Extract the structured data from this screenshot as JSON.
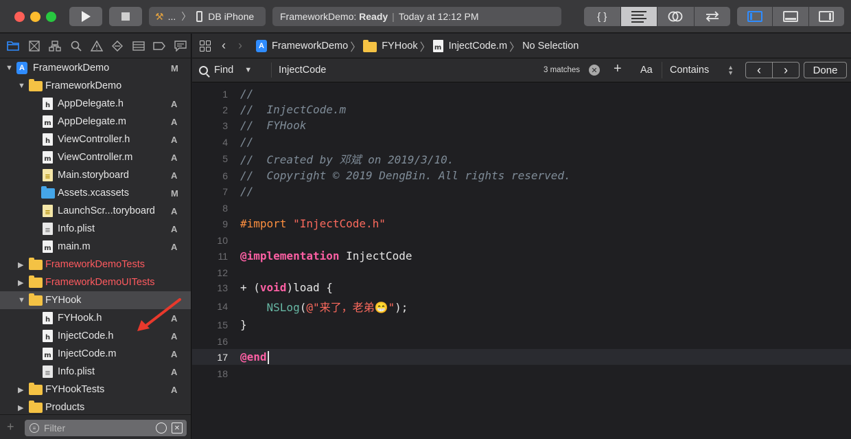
{
  "toolbar": {
    "scheme_dots": "...",
    "destination": "DB iPhone",
    "activity_project": "FrameworkDemo:",
    "activity_status": "Ready",
    "activity_time": "Today at 12:12 PM",
    "editor_modes": [
      "code-review-icon",
      "standard-editor-icon",
      "assistant-editor-icon",
      "version-editor-icon"
    ],
    "editor_standard_glyph": "{ }"
  },
  "navigator": {
    "tabs": [
      "folder-icon",
      "source-control-icon",
      "symbol-icon",
      "search-icon",
      "warning-icon",
      "test-icon",
      "debug-icon",
      "breakpoint-icon",
      "report-icon"
    ],
    "items": [
      {
        "label": "FrameworkDemo",
        "status": "M",
        "kind": "project"
      },
      {
        "label": "FrameworkDemo",
        "status": "",
        "kind": "folder"
      },
      {
        "label": "AppDelegate.h",
        "status": "A",
        "kind": "h"
      },
      {
        "label": "AppDelegate.m",
        "status": "A",
        "kind": "m"
      },
      {
        "label": "ViewController.h",
        "status": "A",
        "kind": "h"
      },
      {
        "label": "ViewController.m",
        "status": "A",
        "kind": "m"
      },
      {
        "label": "Main.storyboard",
        "status": "A",
        "kind": "storyboard"
      },
      {
        "label": "Assets.xcassets",
        "status": "M",
        "kind": "assets"
      },
      {
        "label": "LaunchScr...toryboard",
        "status": "A",
        "kind": "storyboard"
      },
      {
        "label": "Info.plist",
        "status": "A",
        "kind": "plist"
      },
      {
        "label": "main.m",
        "status": "A",
        "kind": "m"
      },
      {
        "label": "FrameworkDemoTests",
        "status": "",
        "kind": "folder-red"
      },
      {
        "label": "FrameworkDemoUITests",
        "status": "",
        "kind": "folder-red"
      },
      {
        "label": "FYHook",
        "status": "",
        "kind": "folder"
      },
      {
        "label": "FYHook.h",
        "status": "A",
        "kind": "h"
      },
      {
        "label": "InjectCode.h",
        "status": "A",
        "kind": "h"
      },
      {
        "label": "InjectCode.m",
        "status": "A",
        "kind": "m"
      },
      {
        "label": "Info.plist",
        "status": "A",
        "kind": "plist"
      },
      {
        "label": "FYHookTests",
        "status": "A",
        "kind": "folder"
      },
      {
        "label": "Products",
        "status": "",
        "kind": "folder"
      }
    ],
    "filter_placeholder": "Filter"
  },
  "jumpbar": {
    "crumbs": [
      "FrameworkDemo",
      "FYHook",
      "InjectCode.m",
      "No Selection"
    ]
  },
  "findbar": {
    "mode": "Find",
    "query": "InjectCode",
    "match_count": "3 matches",
    "case_label": "Aa",
    "match_type": "Contains",
    "done_label": "Done"
  },
  "code": {
    "current_line": 17,
    "lines": [
      {
        "n": "1",
        "text": "//"
      },
      {
        "n": "2",
        "text": "//  InjectCode.m"
      },
      {
        "n": "3",
        "text": "//  FYHook"
      },
      {
        "n": "4",
        "text": "//"
      },
      {
        "n": "5",
        "text": "//  Created by 邓斌 on 2019/3/10."
      },
      {
        "n": "6",
        "text": "//  Copyright © 2019 DengBin. All rights reserved."
      },
      {
        "n": "7",
        "text": "//"
      },
      {
        "n": "8",
        "text": ""
      },
      {
        "n": "9",
        "pre": "#import",
        "str": "\"InjectCode.h\""
      },
      {
        "n": "10",
        "text": ""
      },
      {
        "n": "11",
        "kw": "@implementation",
        "rest": " InjectCode"
      },
      {
        "n": "12",
        "text": ""
      },
      {
        "n": "13",
        "a": "+ (",
        "kw": "void",
        "rest": ")load {"
      },
      {
        "n": "14",
        "indent": "    ",
        "fn": "NSLog",
        "open": "(",
        "str": "@\"来了，老弟😁\"",
        "close": ");"
      },
      {
        "n": "15",
        "text": "}"
      },
      {
        "n": "16",
        "text": ""
      },
      {
        "n": "17",
        "kw": "@end"
      },
      {
        "n": "18",
        "text": ""
      }
    ]
  },
  "colors": {
    "comment": "#7f8c98",
    "keyword": "#fc5fa3",
    "string": "#fc6a5d",
    "preprocessor": "#fd8f3f",
    "function": "#67b7a4",
    "accent": "#2f8cff",
    "annotation_arrow": "#e8392c"
  }
}
